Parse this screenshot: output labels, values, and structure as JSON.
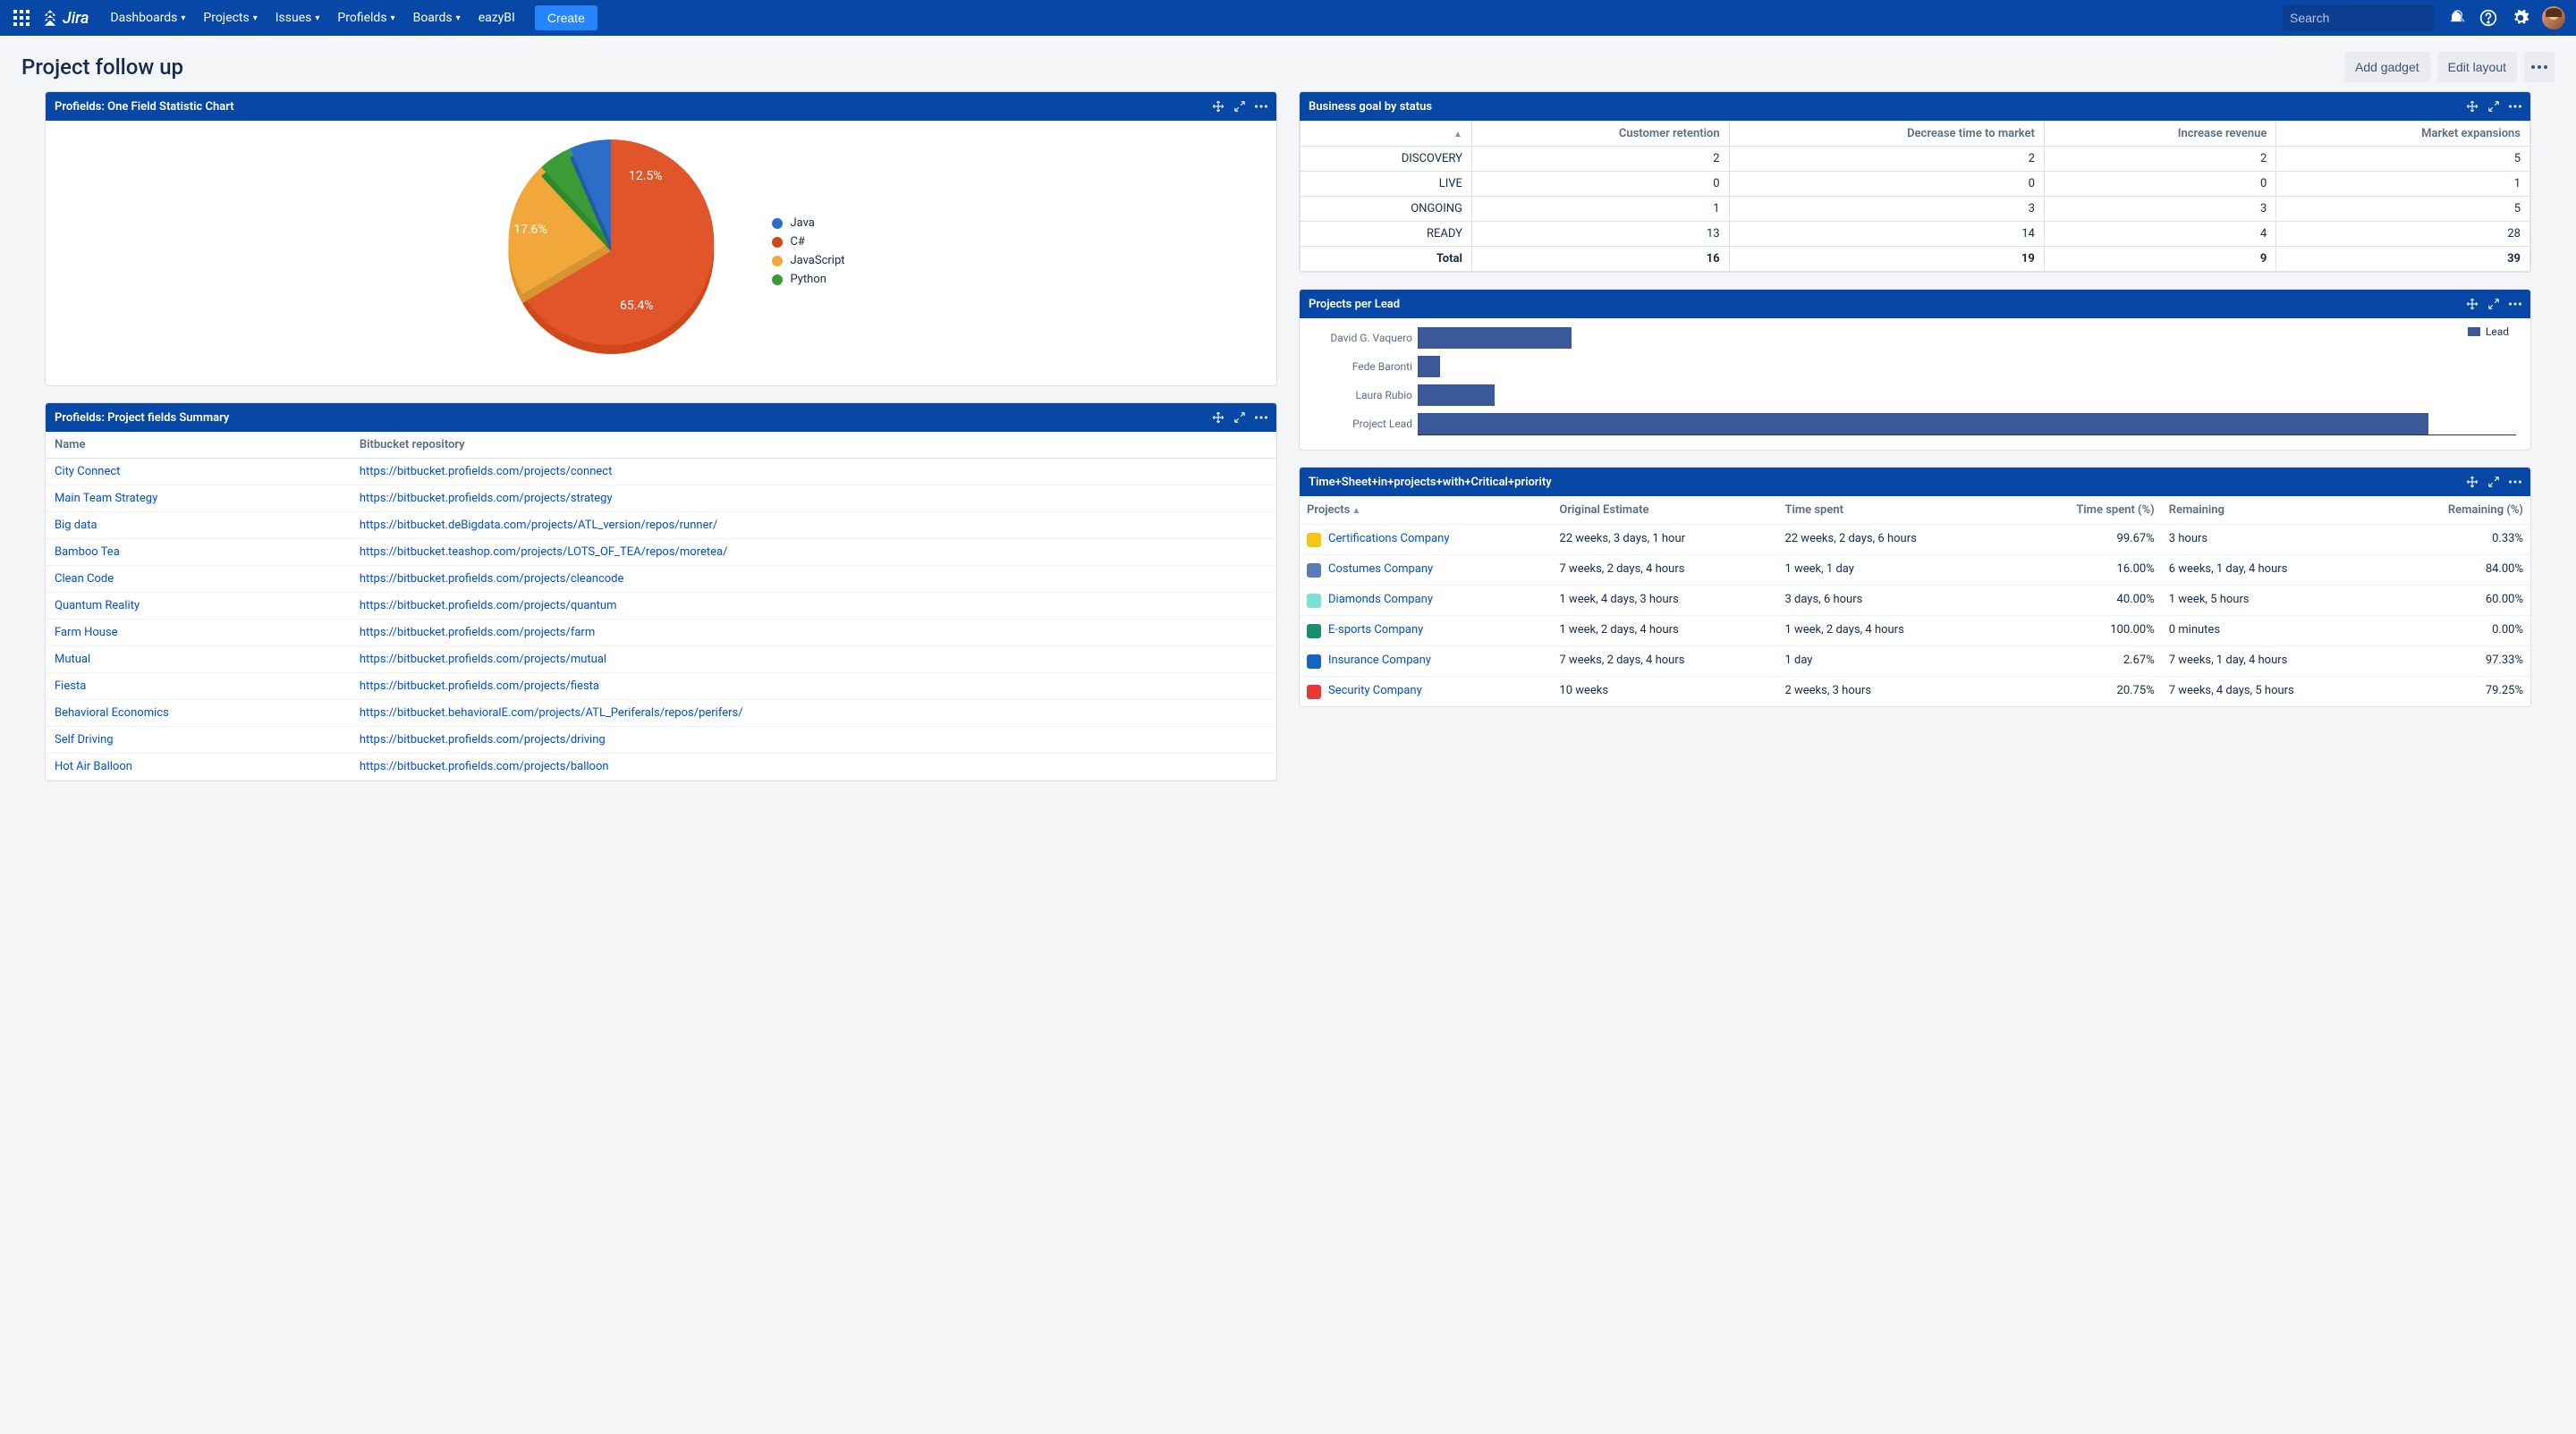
{
  "nav": {
    "logo": "Jira",
    "items": [
      "Dashboards",
      "Projects",
      "Issues",
      "Profields",
      "Boards",
      "eazyBI"
    ],
    "create": "Create",
    "search_placeholder": "Search"
  },
  "page": {
    "title": "Project follow up",
    "actions": {
      "add_gadget": "Add gadget",
      "edit_layout": "Edit layout"
    }
  },
  "pie_gadget": {
    "title": "Profields: One Field Statistic Chart",
    "legend": [
      {
        "label": "Java",
        "color": "#2c6dc7"
      },
      {
        "label": "C#",
        "color": "#d0471b"
      },
      {
        "label": "JavaScript",
        "color": "#f2a73b"
      },
      {
        "label": "Python",
        "color": "#3a9b37"
      }
    ],
    "labels": {
      "java": "12.5%",
      "js": "17.6%",
      "csharp": "65.4%"
    }
  },
  "chart_data": [
    {
      "type": "pie",
      "title": "Profields: One Field Statistic Chart",
      "series": [
        {
          "name": "Java",
          "value": 12.5,
          "color": "#2c6dc7"
        },
        {
          "name": "C#",
          "value": 65.4,
          "color": "#d0471b"
        },
        {
          "name": "JavaScript",
          "value": 17.6,
          "color": "#f2a73b"
        },
        {
          "name": "Python",
          "value": 4.5,
          "color": "#3a9b37"
        }
      ]
    },
    {
      "type": "bar",
      "title": "Projects per Lead",
      "orientation": "horizontal",
      "xlabel": "",
      "ylabel": "",
      "categories": [
        "David G. Vaquero",
        "Fede Baronti",
        "Laura Rubio",
        "Project Lead"
      ],
      "series": [
        {
          "name": "Lead",
          "values": [
            3,
            0.5,
            1.5,
            20
          ],
          "color": "#3b5998"
        }
      ],
      "xlim": [
        0,
        22
      ]
    },
    {
      "type": "table",
      "title": "Business goal by status",
      "columns": [
        "",
        "Customer retention",
        "Decrease time to market",
        "Increase revenue",
        "Market expansions"
      ],
      "rows": [
        [
          "DISCOVERY",
          2,
          2,
          2,
          5
        ],
        [
          "LIVE",
          0,
          0,
          0,
          1
        ],
        [
          "ONGOING",
          1,
          3,
          3,
          5
        ],
        [
          "READY",
          13,
          14,
          4,
          28
        ],
        [
          "Total",
          16,
          19,
          9,
          39
        ]
      ]
    }
  ],
  "summary_gadget": {
    "title": "Profields: Project fields Summary",
    "headers": {
      "name": "Name",
      "repo": "Bitbucket repository"
    },
    "rows": [
      {
        "name": "City Connect",
        "repo": "https://bitbucket.profields.com/projects/connect"
      },
      {
        "name": "Main Team Strategy",
        "repo": "https://bitbucket.profields.com/projects/strategy"
      },
      {
        "name": "Big data",
        "repo": "https://bitbucket.deBigdata.com/projects/ATL_version/repos/runner/"
      },
      {
        "name": "Bamboo Tea",
        "repo": "https://bitbucket.teashop.com/projects/LOTS_OF_TEA/repos/moretea/"
      },
      {
        "name": "Clean Code",
        "repo": "https://bitbucket.profields.com/projects/cleancode"
      },
      {
        "name": "Quantum Reality",
        "repo": "https://bitbucket.profields.com/projects/quantum"
      },
      {
        "name": "Farm House",
        "repo": "https://bitbucket.profields.com/projects/farm"
      },
      {
        "name": "Mutual",
        "repo": "https://bitbucket.profields.com/projects/mutual"
      },
      {
        "name": "Fiesta",
        "repo": "https://bitbucket.profields.com/projects/fiesta"
      },
      {
        "name": "Behavioral Economics",
        "repo": "https://bitbucket.behavioralE.com/projects/ATL_Periferals/repos/perifers/"
      },
      {
        "name": "Self Driving",
        "repo": "https://bitbucket.profields.com/projects/driving"
      },
      {
        "name": "Hot Air Balloon",
        "repo": "https://bitbucket.profields.com/projects/balloon"
      }
    ]
  },
  "biz_gadget": {
    "title": "Business goal by status",
    "headers": [
      "",
      "Customer retention",
      "Decrease time to market",
      "Increase revenue",
      "Market expansions"
    ],
    "rows": [
      {
        "label": "DISCOVERY",
        "v": [
          "2",
          "2",
          "2",
          "5"
        ]
      },
      {
        "label": "LIVE",
        "v": [
          "0",
          "0",
          "0",
          "1"
        ]
      },
      {
        "label": "ONGOING",
        "v": [
          "1",
          "3",
          "3",
          "5"
        ]
      },
      {
        "label": "READY",
        "v": [
          "13",
          "14",
          "4",
          "28"
        ]
      }
    ],
    "total": {
      "label": "Total",
      "v": [
        "16",
        "19",
        "9",
        "39"
      ]
    }
  },
  "lead_gadget": {
    "title": "Projects per Lead",
    "legend": "Lead",
    "bars": [
      {
        "label": "David G. Vaquero",
        "pct": 14
      },
      {
        "label": "Fede Baronti",
        "pct": 2
      },
      {
        "label": "Laura Rubio",
        "pct": 7
      },
      {
        "label": "Project Lead",
        "pct": 92
      }
    ]
  },
  "ts_gadget": {
    "title": "Time+Sheet+in+projects+with+Critical+priority",
    "headers": {
      "projects": "Projects",
      "orig": "Original Estimate",
      "spent": "Time spent",
      "spent_pct": "Time spent (%)",
      "remain": "Remaining",
      "remain_pct": "Remaining (%)"
    },
    "rows": [
      {
        "icon": "#f5c518",
        "name": "Certifications Company",
        "orig": "22 weeks, 3 days, 1 hour",
        "spent": "22 weeks, 2 days, 6 hours",
        "spent_pct": "99.67%",
        "remain": "3 hours",
        "remain_pct": "0.33%"
      },
      {
        "icon": "#5b7bb8",
        "name": "Costumes Company",
        "orig": "7 weeks, 2 days, 4 hours",
        "spent": "1 week, 1 day",
        "spent_pct": "16.00%",
        "remain": "6 weeks, 1 day, 4 hours",
        "remain_pct": "84.00%"
      },
      {
        "icon": "#7de2d1",
        "name": "Diamonds Company",
        "orig": "1 week, 4 days, 3 hours",
        "spent": "3 days, 6 hours",
        "spent_pct": "40.00%",
        "remain": "1 week, 5 hours",
        "remain_pct": "60.00%"
      },
      {
        "icon": "#1a8f6e",
        "name": "E-sports Company",
        "orig": "1 week, 2 days, 4 hours",
        "spent": "1 week, 2 days, 4 hours",
        "spent_pct": "100.00%",
        "remain": "0 minutes",
        "remain_pct": "0.00%"
      },
      {
        "icon": "#1565c0",
        "name": "Insurance Company",
        "orig": "7 weeks, 2 days, 4 hours",
        "spent": "1 day",
        "spent_pct": "2.67%",
        "remain": "7 weeks, 1 day, 4 hours",
        "remain_pct": "97.33%"
      },
      {
        "icon": "#e53935",
        "name": "Security Company",
        "orig": "10 weeks",
        "spent": "2 weeks, 3 hours",
        "spent_pct": "20.75%",
        "remain": "7 weeks, 4 days, 5 hours",
        "remain_pct": "79.25%"
      }
    ]
  }
}
